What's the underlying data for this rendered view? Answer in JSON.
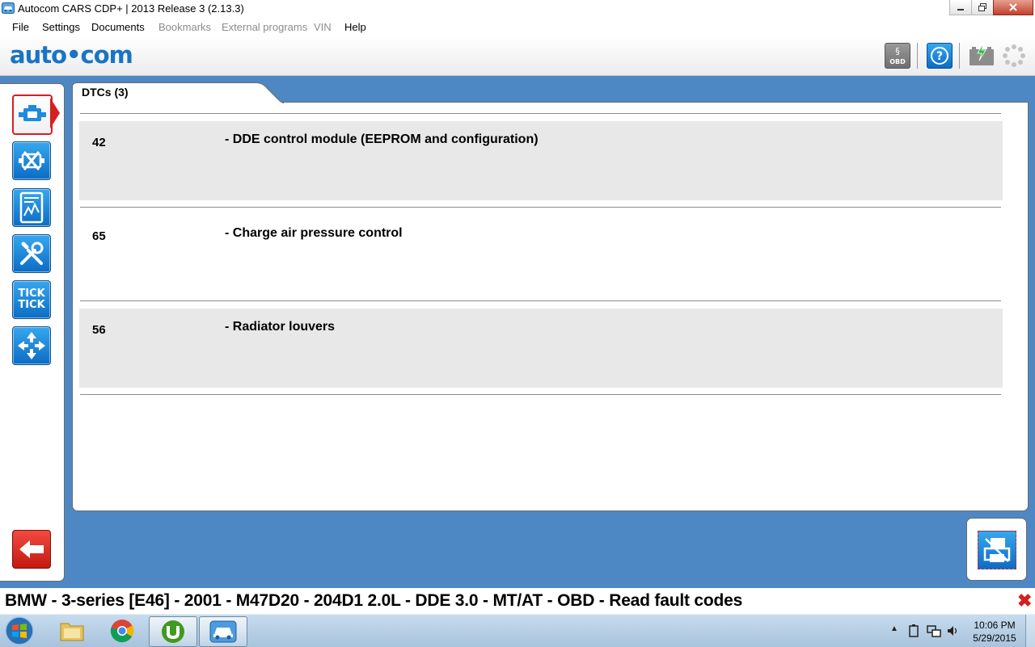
{
  "window": {
    "title": "Autocom CARS CDP+ | 2013 Release 3 (2.13.3)"
  },
  "menu": {
    "items": [
      {
        "label": "File",
        "enabled": true
      },
      {
        "label": "Settings",
        "enabled": true
      },
      {
        "label": "Documents",
        "enabled": true
      },
      {
        "label": "Bookmarks",
        "enabled": false
      },
      {
        "label": "External programs",
        "enabled": false
      },
      {
        "label": "VIN",
        "enabled": false
      },
      {
        "label": "Help",
        "enabled": true
      }
    ]
  },
  "toolbar": {
    "logo": "auto•com",
    "obd_label": "OBD",
    "icons": [
      "obd-legislation-icon",
      "help-icon",
      "battery-icon",
      "connection-spinner-icon"
    ]
  },
  "sidebar": {
    "items": [
      {
        "name": "engine-dtc",
        "icon": "engine-icon",
        "active": true
      },
      {
        "name": "erase-dtc",
        "icon": "engine-crossed-icon",
        "active": false
      },
      {
        "name": "live-data",
        "icon": "graph-icon",
        "active": false
      },
      {
        "name": "adjustments",
        "icon": "tools-icon",
        "active": false
      },
      {
        "name": "activation",
        "icon": "tick-tick-icon",
        "active": false
      },
      {
        "name": "other",
        "icon": "arrows-icon",
        "active": false
      }
    ],
    "tick_text": "TICK",
    "back_icon": "arrow-left-icon"
  },
  "main": {
    "tab_label": "DTCs (3)",
    "dtcs": [
      {
        "code": "42",
        "description": "- DDE control module (EEPROM and configuration)"
      },
      {
        "code": "65",
        "description": "- Charge air pressure control"
      },
      {
        "code": "56",
        "description": "- Radiator louvers"
      }
    ]
  },
  "status": {
    "text": "BMW - 3-series [E46] - 2001 - M47D20 - 204D1 2.0L - DDE 3.0 - MT/AT - OBD - Read fault codes",
    "close_glyph": "✖"
  },
  "taskbar": {
    "apps": [
      "windows-start-icon",
      "file-explorer-icon",
      "chrome-icon",
      "utorrent-icon",
      "autocom-car-icon"
    ],
    "time": "10:06 PM",
    "date": "5/29/2015"
  },
  "colors": {
    "accent_blue": "#1a74c4",
    "background_blue": "#4d88c4",
    "active_red": "#d42020"
  }
}
